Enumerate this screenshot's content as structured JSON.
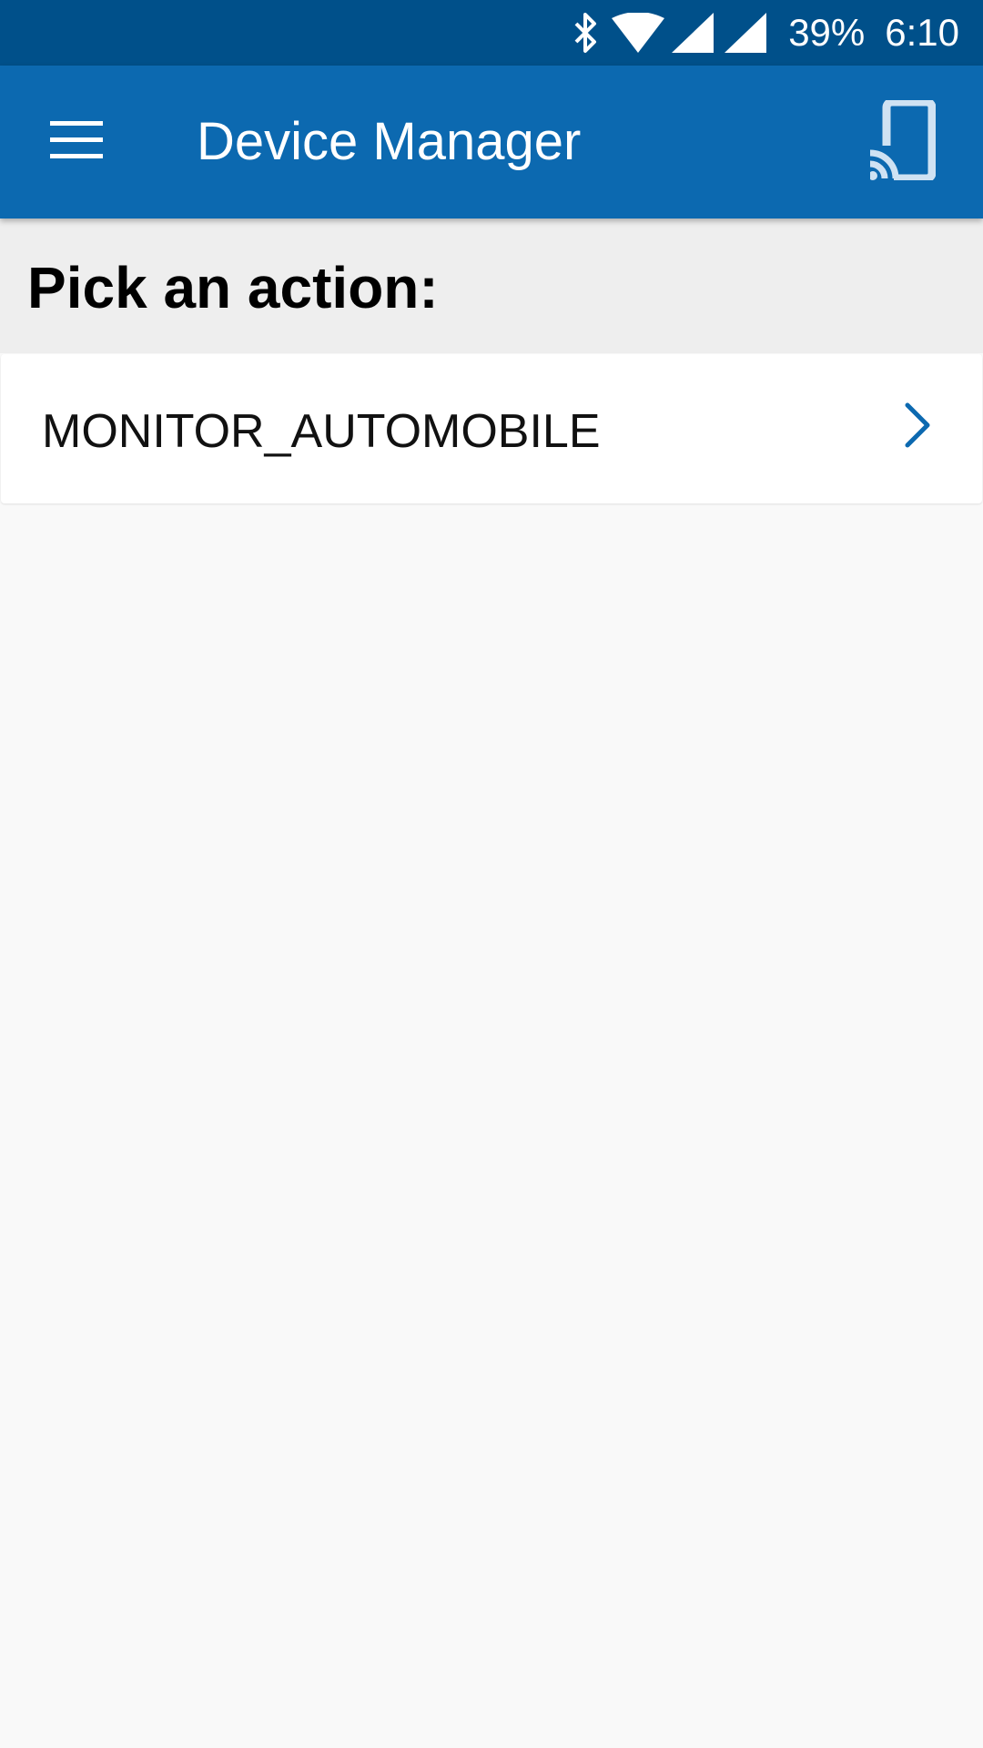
{
  "status_bar": {
    "battery": "39%",
    "time": "6:10",
    "icons": [
      "bluetooth-icon",
      "wifi-icon",
      "signal-icon",
      "signal-icon"
    ]
  },
  "app_bar": {
    "title": "Device Manager",
    "menu_icon": "hamburger-menu-icon",
    "cast_icon": "cast-icon"
  },
  "section": {
    "title": "Pick an action:"
  },
  "actions": [
    {
      "label": "MONITOR_AUTOMOBILE",
      "icon": "chevron-right-icon"
    }
  ],
  "colors": {
    "status_bar": "#00508a",
    "app_bar": "#0c69b0",
    "accent": "#0c69b0",
    "background": "#f9f9f9",
    "section_header": "#eeeeee"
  }
}
